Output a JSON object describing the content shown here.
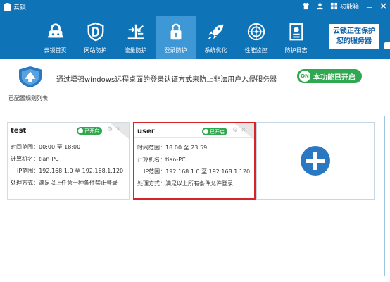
{
  "app": {
    "title": "云锁"
  },
  "titlebar": {
    "func_label": "功能箱"
  },
  "nav": [
    {
      "label": "云锁首页",
      "icon": "lock-home-icon"
    },
    {
      "label": "网站防护",
      "icon": "shield-d-icon"
    },
    {
      "label": "流量防护",
      "icon": "flow-arrows-icon"
    },
    {
      "label": "登录防护",
      "icon": "padlock-icon",
      "active": true
    },
    {
      "label": "系统优化",
      "icon": "rocket-icon"
    },
    {
      "label": "性能监控",
      "icon": "radar-icon"
    },
    {
      "label": "防护日志",
      "icon": "log-document-icon"
    }
  ],
  "promo": {
    "line1": "云锁正在保护",
    "line2": "您的服务器"
  },
  "info": {
    "config_label": "已配置规则列表",
    "description": "通过增强windows远程桌面的登录认证方式来防止非法用户入侵服务器",
    "status_on": "ON",
    "status_text": "本功能已开启"
  },
  "rules": [
    {
      "name": "test",
      "badge": "已开启",
      "time_label": "时间范围：",
      "time": "00:00 至 18:00",
      "host_label": "计算机名：",
      "host": "tian-PC",
      "ip_label": "IP范围：",
      "ip": "192.168.1.0 至 192.168.1.120",
      "action_label": "处理方式：",
      "action": "满足以上任意一种条件禁止登录"
    },
    {
      "name": "user",
      "badge": "已开启",
      "time_label": "时间范围：",
      "time": "18:00 至 23:59",
      "host_label": "计算机名：",
      "host": "tian-PC",
      "ip_label": "IP范围：",
      "ip": "192.168.1.0 至 192.168.1.120",
      "action_label": "处理方式：",
      "action": "满足以上所有条件允许登录"
    }
  ],
  "colors": {
    "brand_blue": "#0f73b8",
    "active_tab": "#3f98d6",
    "on_green": "#2fa84f",
    "selected_border": "#d9232a"
  }
}
